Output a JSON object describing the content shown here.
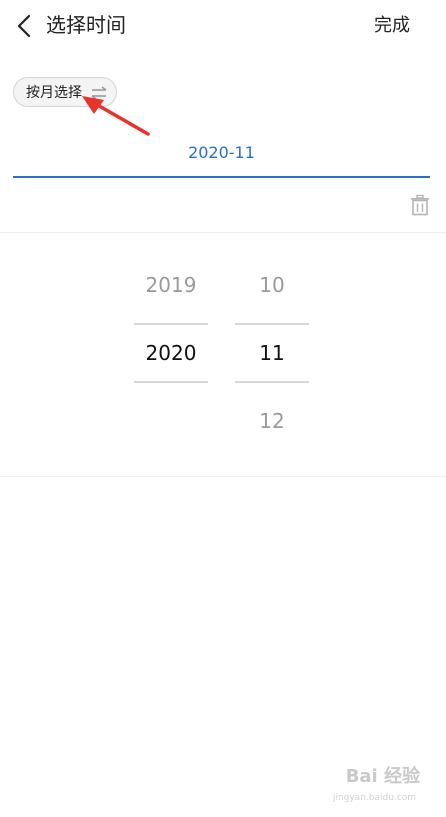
{
  "header": {
    "title": "选择时间",
    "done_label": "完成"
  },
  "mode_toggle": {
    "label": "按月选择",
    "icon": "swap-icon"
  },
  "date_field": {
    "value": "2020-11"
  },
  "picker": {
    "years": {
      "previous": "2019",
      "selected": "2020"
    },
    "months": {
      "previous": "10",
      "selected": "11",
      "next": "12"
    }
  },
  "annotation": {
    "color": "#e8322b"
  },
  "watermark": {
    "text": "Bai 经验",
    "sub": "jingyan.baidu.com"
  },
  "colors": {
    "accent": "#2a6fc9"
  }
}
